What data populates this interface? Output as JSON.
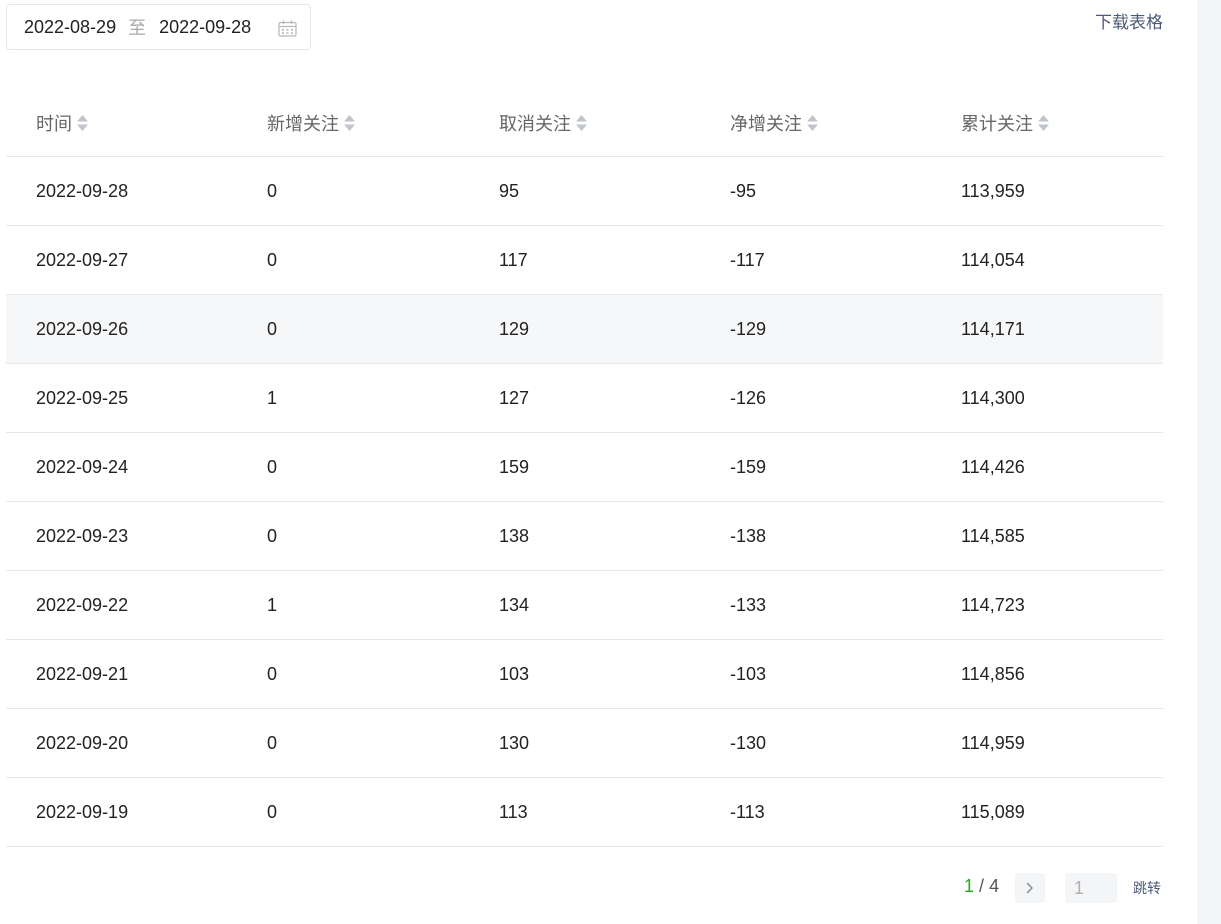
{
  "filter": {
    "start_date": "2022-08-29",
    "separator": "至",
    "end_date": "2022-09-28",
    "calendar_icon": "calendar-icon"
  },
  "actions": {
    "download": "下载表格"
  },
  "table": {
    "columns": [
      "时间",
      "新增关注",
      "取消关注",
      "净增关注",
      "累计关注"
    ],
    "sort_icon": "sort-icon",
    "rows": [
      [
        "2022-09-28",
        "0",
        "95",
        "-95",
        "113,959"
      ],
      [
        "2022-09-27",
        "0",
        "117",
        "-117",
        "114,054"
      ],
      [
        "2022-09-26",
        "0",
        "129",
        "-129",
        "114,171"
      ],
      [
        "2022-09-25",
        "1",
        "127",
        "-126",
        "114,300"
      ],
      [
        "2022-09-24",
        "0",
        "159",
        "-159",
        "114,426"
      ],
      [
        "2022-09-23",
        "0",
        "138",
        "-138",
        "114,585"
      ],
      [
        "2022-09-22",
        "1",
        "134",
        "-133",
        "114,723"
      ],
      [
        "2022-09-21",
        "0",
        "103",
        "-103",
        "114,856"
      ],
      [
        "2022-09-20",
        "0",
        "130",
        "-130",
        "114,959"
      ],
      [
        "2022-09-19",
        "0",
        "113",
        "-113",
        "115,089"
      ]
    ]
  },
  "pagination": {
    "current": "1",
    "divider": "/",
    "total": "4",
    "next_icon": "chevron-right-icon",
    "jump_placeholder": "1",
    "jump_label": "跳转"
  },
  "colors": {
    "link": "#4c5a75",
    "current_page": "#1aad19",
    "border": "#e7e7eb",
    "row_hover": "#f6f7f8"
  }
}
